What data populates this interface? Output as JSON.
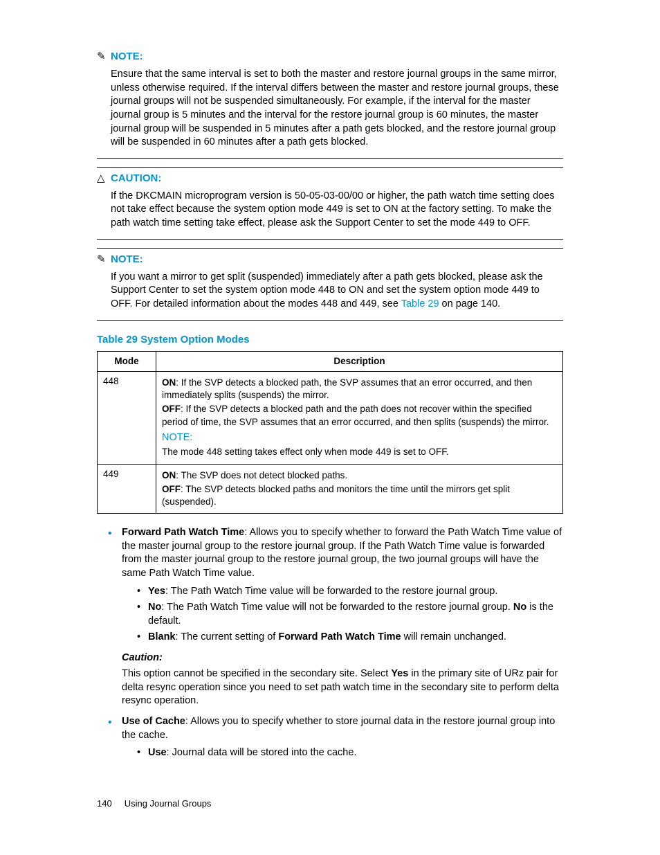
{
  "note1": {
    "heading": "NOTE:",
    "body": "Ensure that the same interval is set to both the master and restore journal groups in the same mirror, unless otherwise required. If the interval differs between the master and restore journal groups, these journal groups will not be suspended simultaneously. For example, if the interval for the master journal group is 5 minutes and the interval for the restore journal group is 60 minutes, the master journal group will be suspended in 5 minutes after a path gets blocked, and the restore journal group will be suspended in 60 minutes after a path gets blocked."
  },
  "caution1": {
    "heading": "CAUTION:",
    "body": "If the DKCMAIN microprogram version is 50-05-03-00/00 or higher, the path watch time setting does not take effect because the system option mode 449 is set to ON at the factory setting. To make the path watch time setting take effect, please ask the Support Center to set the mode 449 to OFF."
  },
  "note2": {
    "heading": "NOTE:",
    "body_pre": "If you want a mirror to get split (suspended) immediately after a path gets blocked, please ask the Support Center to set the system option mode 448 to ON and set the system option mode 449 to OFF. For detailed information about the modes 448 and 449, see ",
    "link": "Table 29",
    "body_post": " on page 140."
  },
  "table": {
    "title": "Table 29 System Option Modes",
    "head_mode": "Mode",
    "head_desc": "Description",
    "row1_mode": "448",
    "row1_on_label": "ON",
    "row1_on_text": ": If the SVP detects a blocked path, the SVP assumes that an error occurred, and then immediately splits (suspends) the mirror.",
    "row1_off_label": "OFF",
    "row1_off_text": ": If the SVP detects a blocked path and the path does not recover within the specified period of time, the SVP assumes that an error occurred, and then splits (suspends) the mirror.",
    "row1_note_heading": "NOTE:",
    "row1_note_text": "The mode 448 setting takes effect only when mode 449 is set to OFF.",
    "row2_mode": "449",
    "row2_on_label": "ON",
    "row2_on_text": ": The SVP does not detect blocked paths.",
    "row2_off_label": "OFF",
    "row2_off_text": ": The SVP detects blocked paths and monitors the time until the mirrors get split (suspended)."
  },
  "bullets": {
    "fpwt_label": "Forward Path Watch Time",
    "fpwt_text": ": Allows you to specify whether to forward the Path Watch Time value of the master journal group to the restore journal group. If the Path Watch Time value is forwarded from the master journal group to the restore journal group, the two journal groups will have the same Path Watch Time value.",
    "yes_label": "Yes",
    "yes_text": ": The Path Watch Time value will be forwarded to the restore journal group.",
    "no_label": "No",
    "no_text1": ": The Path Watch Time value will not be forwarded to the restore journal group. ",
    "no_bold": "No",
    "no_text2": " is the default.",
    "blank_label": "Blank",
    "blank_text1": ": The current setting of ",
    "blank_bold": "Forward Path Watch Time",
    "blank_text2": " will remain unchanged.",
    "caution_heading": "Caution:",
    "caution_text1": "This option cannot be specified in the secondary site. Select ",
    "caution_yes": "Yes",
    "caution_text2": " in the primary site of URz pair for delta resync operation since you need to set path watch time in the secondary site to perform delta resync operation.",
    "uoc_label": "Use of Cache",
    "uoc_text": ": Allows you to specify whether to store journal data in the restore journal group into the cache.",
    "use_label": "Use",
    "use_text": ": Journal data will be stored into the cache."
  },
  "footer": {
    "page": "140",
    "section": "Using Journal Groups"
  }
}
